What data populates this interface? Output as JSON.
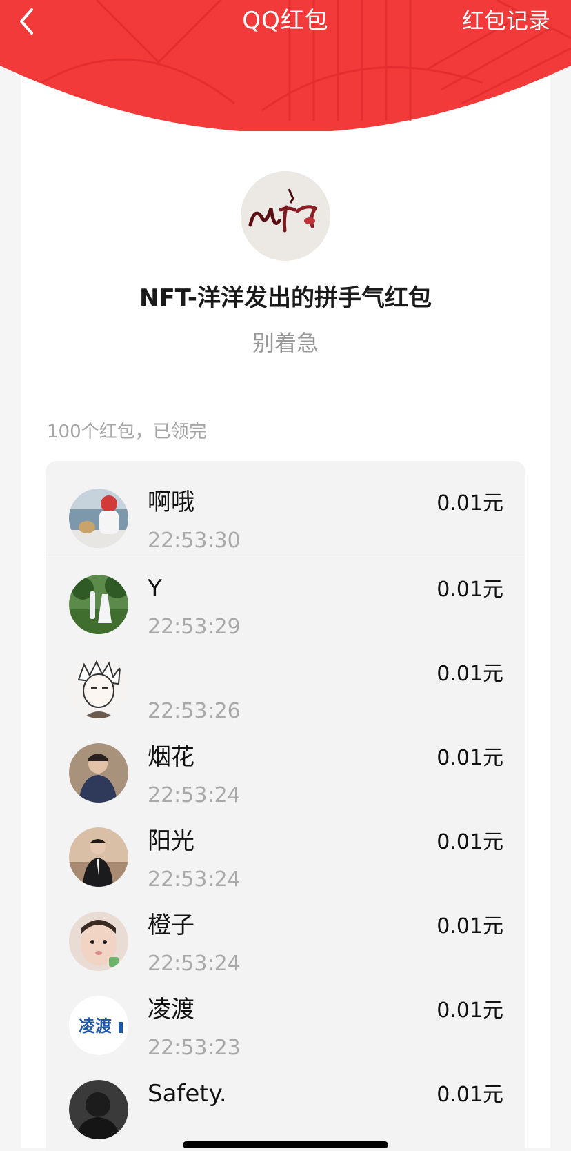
{
  "header": {
    "title": "QQ红包",
    "record_label": "红包记录",
    "back_icon": "chevron-left-icon",
    "color": "#f2393a"
  },
  "sender": {
    "avatar_text": "NFT",
    "title": "NFT-洋洋发出的拼手气红包",
    "message": "别着急"
  },
  "summary": "100个红包，已领完",
  "recipients": [
    {
      "name": "啊哦",
      "time": "22:53:30",
      "amount": "0.01元",
      "avatar_color": "#8aa2b5"
    },
    {
      "name": "Y",
      "time": "22:53:29",
      "amount": "0.01元",
      "avatar_color": "#4b7a3a"
    },
    {
      "name": "",
      "time": "22:53:26",
      "amount": "0.01元",
      "avatar_color": "#f2f0ee"
    },
    {
      "name": "烟花",
      "time": "22:53:24",
      "amount": "0.01元",
      "avatar_color": "#3a3f55"
    },
    {
      "name": "阳光",
      "time": "22:53:24",
      "amount": "0.01元",
      "avatar_color": "#c9a98c"
    },
    {
      "name": "橙子",
      "time": "22:53:24",
      "amount": "0.01元",
      "avatar_color": "#d6c4bb"
    },
    {
      "name": "凌渡",
      "time": "22:53:23",
      "amount": "0.01元",
      "avatar_color": "#ffffff",
      "avatar_text": "凌渡"
    },
    {
      "name": "Safety.",
      "time": "",
      "amount": "0.01元",
      "avatar_color": "#2c2c2c"
    }
  ]
}
